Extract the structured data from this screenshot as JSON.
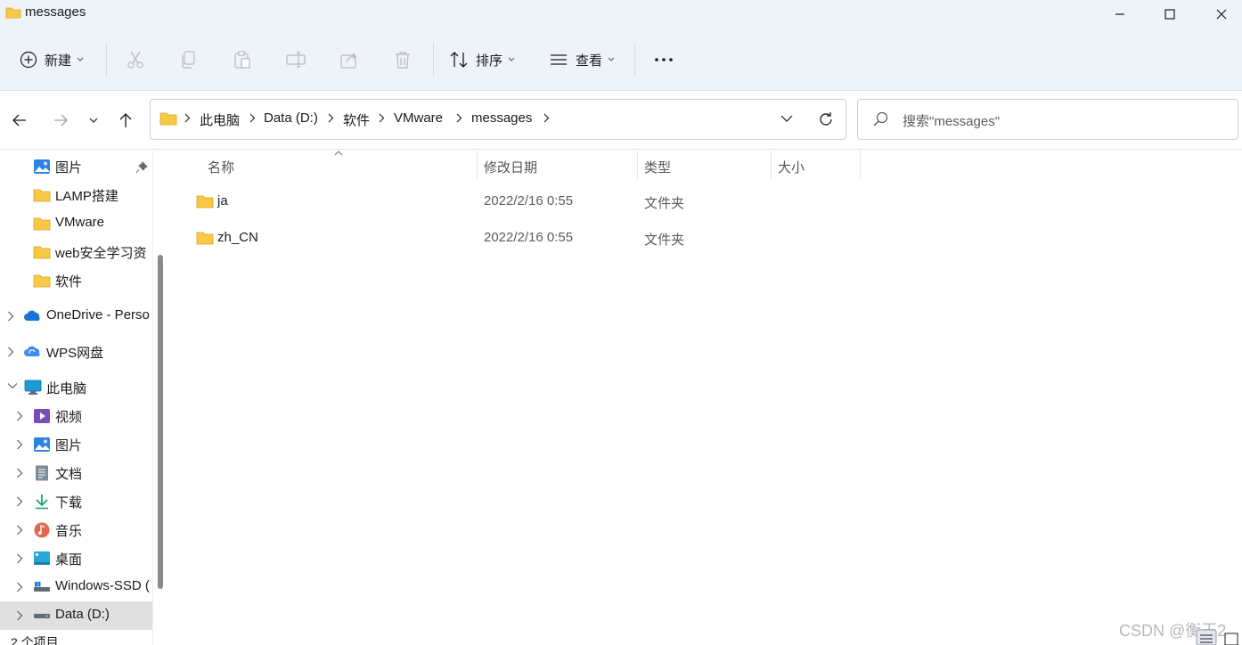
{
  "window": {
    "title": "messages"
  },
  "toolbar": {
    "new_label": "新建",
    "sort_label": "排序",
    "view_label": "查看",
    "more_label": "•••"
  },
  "address": {
    "crumbs": [
      "此电脑",
      "Data (D:)",
      "软件",
      "VMware",
      "messages"
    ]
  },
  "search": {
    "placeholder": "搜索\"messages\""
  },
  "sidebar": {
    "items": [
      {
        "label": "图片",
        "icon": "pictures-icon",
        "pinned": true
      },
      {
        "label": "LAMP搭建",
        "icon": "folder-icon"
      },
      {
        "label": "VMware",
        "icon": "folder-icon"
      },
      {
        "label": "web安全学习资",
        "icon": "folder-icon"
      },
      {
        "label": "软件",
        "icon": "folder-icon"
      },
      {
        "label": "OneDrive - Perso",
        "icon": "onedrive-cloud-icon"
      },
      {
        "label": "WPS网盘",
        "icon": "wps-cloud-icon"
      },
      {
        "label": "此电脑",
        "icon": "this-pc-icon"
      },
      {
        "label": "视频",
        "icon": "videos-icon"
      },
      {
        "label": "图片",
        "icon": "pictures-icon"
      },
      {
        "label": "文档",
        "icon": "documents-icon"
      },
      {
        "label": "下载",
        "icon": "downloads-icon"
      },
      {
        "label": "音乐",
        "icon": "music-icon"
      },
      {
        "label": "桌面",
        "icon": "desktop-icon"
      },
      {
        "label": "Windows-SSD (",
        "icon": "drive-icon"
      },
      {
        "label": "Data (D:)",
        "icon": "drive-icon",
        "selected": true
      }
    ]
  },
  "columns": {
    "name": "名称",
    "modified": "修改日期",
    "type": "类型",
    "size": "大小"
  },
  "files": [
    {
      "name": "ja",
      "modified": "2022/2/16 0:55",
      "type": "文件夹"
    },
    {
      "name": "zh_CN",
      "modified": "2022/2/16 0:55",
      "type": "文件夹"
    }
  ],
  "status": {
    "item_count": "2 个项目"
  },
  "watermark": "CSDN @衡王2",
  "colors": {
    "chrome_bg": "#eef2f9",
    "folder_yellow": "#f8c944",
    "accent_blue": "#1a73d6"
  }
}
